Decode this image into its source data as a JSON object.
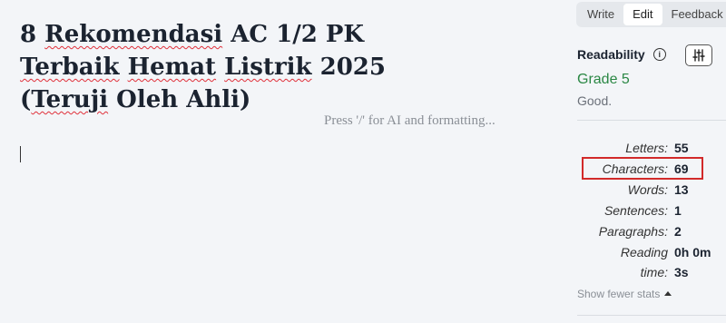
{
  "editor": {
    "title_lines": [
      "8 Rekomendasi AC 1/2 PK",
      "Terbaik Hemat Listrik 2025",
      "(Teruji Oleh Ahli)"
    ],
    "placeholder": "Press '/' for AI and formatting..."
  },
  "modes": {
    "write": "Write",
    "edit": "Edit",
    "feedback": "Feedback",
    "active": "Edit"
  },
  "readability": {
    "label": "Readability",
    "info_icon": "i",
    "grade": "Grade 5",
    "summary": "Good."
  },
  "stats": [
    {
      "label": "Letters:",
      "value": "55"
    },
    {
      "label": "Characters:",
      "value": "69"
    },
    {
      "label": "Words:",
      "value": "13"
    },
    {
      "label": "Sentences:",
      "value": "1"
    },
    {
      "label": "Paragraphs:",
      "value": "2"
    },
    {
      "label": "Reading",
      "value": "0h 0m"
    },
    {
      "label": "time:",
      "value": "3s"
    }
  ],
  "show_fewer": "Show fewer stats",
  "colors": {
    "grade": "#2a8744",
    "highlight": "#d22a2a",
    "title": "#1b2330"
  }
}
